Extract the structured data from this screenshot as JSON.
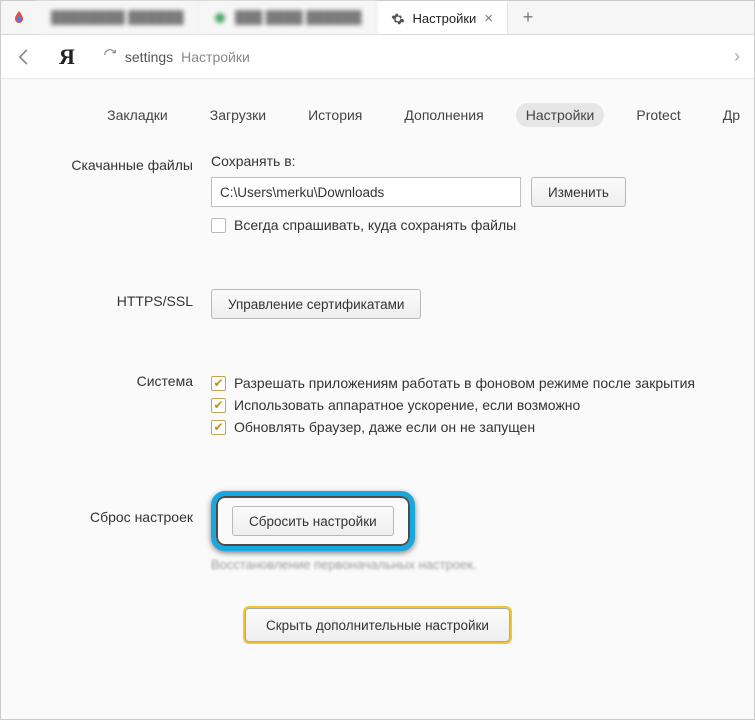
{
  "tabs": {
    "active_title": "Настройки",
    "new_hint": "+"
  },
  "address_bar": {
    "url_primary": "settings",
    "url_secondary": "Настройки"
  },
  "nav": {
    "items": [
      "Закладки",
      "Загрузки",
      "История",
      "Дополнения",
      "Настройки",
      "Protect",
      "Др"
    ]
  },
  "downloads": {
    "section_label": "Скачанные файлы",
    "save_to_label": "Сохранять в:",
    "path_value": "C:\\Users\\merku\\Downloads",
    "change_button": "Изменить",
    "always_ask": "Всегда спрашивать, куда сохранять файлы"
  },
  "https": {
    "section_label": "HTTPS/SSL",
    "manage_certs": "Управление сертификатами"
  },
  "system": {
    "section_label": "Система",
    "bg_apps": "Разрешать приложениям работать в фоновом режиме после закрытия",
    "hw_accel": "Использовать аппаратное ускорение, если возможно",
    "auto_update": "Обновлять браузер, даже если он не запущен"
  },
  "reset": {
    "section_label": "Сброс настроек",
    "button": "Сбросить настройки",
    "hint": "Восстановление первоначальных настроек."
  },
  "footer": {
    "hide_advanced": "Скрыть дополнительные настройки"
  }
}
